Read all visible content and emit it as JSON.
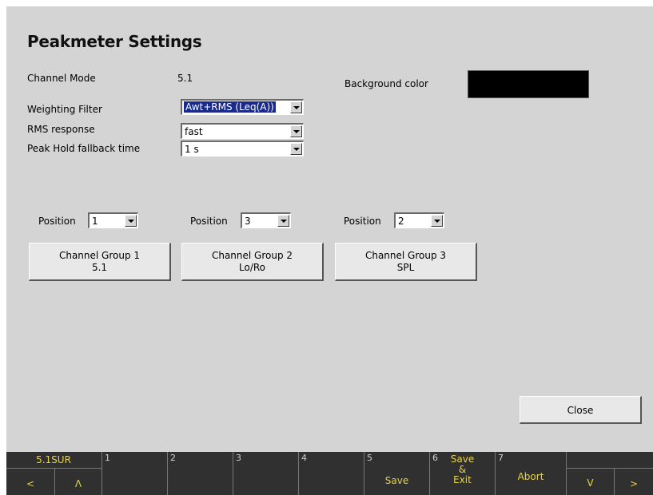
{
  "title": "Peakmeter Settings",
  "settings": {
    "channel_mode_label": "Channel Mode",
    "channel_mode_value": "5.1",
    "background_color_label": "Background color",
    "background_color_value": "#000000",
    "weighting_filter_label": "Weighting Filter",
    "weighting_filter_value": "Awt+RMS (Leq(A))",
    "rms_response_label": "RMS response",
    "rms_response_value": "fast",
    "peak_hold_label": "Peak Hold fallback time",
    "peak_hold_value": "1 s"
  },
  "groups": [
    {
      "position_label": "Position",
      "position_value": "1",
      "name": "Channel Group 1",
      "mode": "5.1"
    },
    {
      "position_label": "Position",
      "position_value": "3",
      "name": "Channel Group 2",
      "mode": "Lo/Ro"
    },
    {
      "position_label": "Position",
      "position_value": "2",
      "name": "Channel Group 3",
      "mode": "SPL"
    }
  ],
  "close_label": "Close",
  "softkeys": {
    "mode": "5.1SUR",
    "left_arrow": "<",
    "up_arrow": "Λ",
    "keys": [
      {
        "num": "1",
        "label": ""
      },
      {
        "num": "2",
        "label": ""
      },
      {
        "num": "3",
        "label": ""
      },
      {
        "num": "4",
        "label": ""
      },
      {
        "num": "5",
        "label": "Save"
      },
      {
        "num": "6",
        "label_line1": "Save",
        "label_line2": "&",
        "label_line3": "Exit"
      },
      {
        "num": "7",
        "label": "Abort"
      }
    ],
    "down_arrow": "V",
    "right_arrow": ">"
  },
  "colors": {
    "screen_bg": "#d4d4d4",
    "softkey_bar": "#303030",
    "softkey_text": "#e8d340",
    "selection": "#1a2a8a"
  }
}
